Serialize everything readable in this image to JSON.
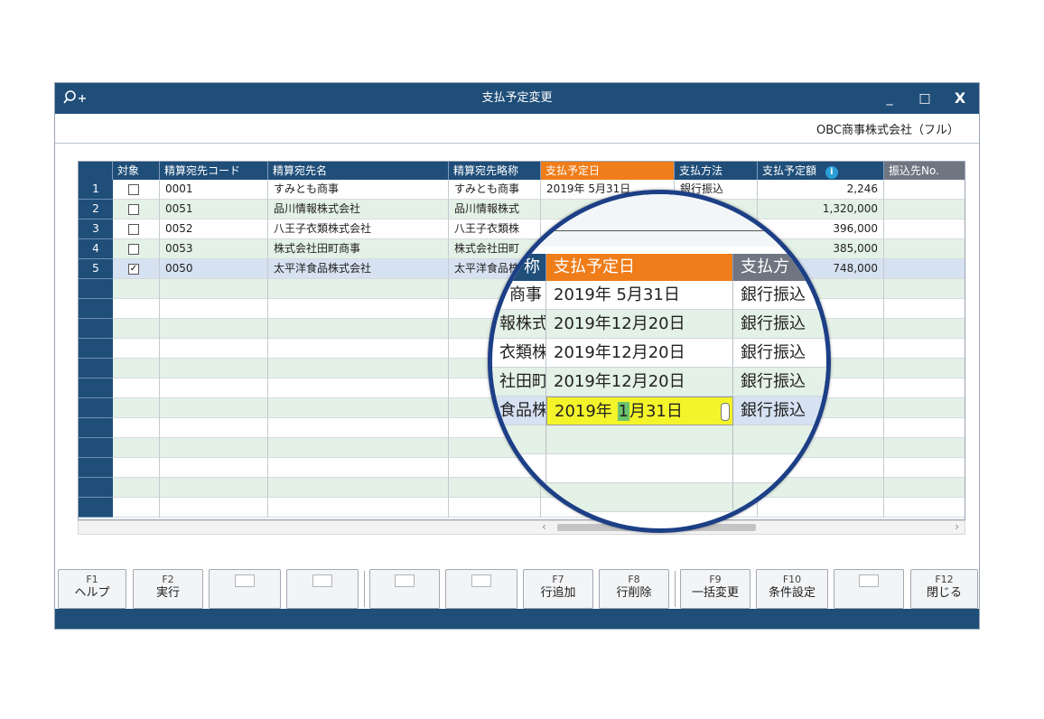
{
  "window": {
    "title": "支払予定変更",
    "company": "OBC商事株式会社（フル）",
    "controls": {
      "minimize": "_",
      "maximize": "□",
      "close": "X"
    }
  },
  "icons": {
    "search": "search-plus-icon"
  },
  "grid": {
    "headers": [
      "対象",
      "精算宛先コード",
      "精算宛先名",
      "精算宛先略称",
      "支払予定日",
      "支払方法",
      "支払予定額",
      "振込先No."
    ],
    "info_icon": "i",
    "rows": [
      {
        "no": "1",
        "checked": "",
        "code": "0001",
        "name": "すみとも商事",
        "short": "すみとも商事",
        "date": "2019年 5月31日",
        "method": "銀行振込",
        "amount": "2,246"
      },
      {
        "no": "2",
        "checked": "",
        "code": "0051",
        "name": "品川情報株式会社",
        "short": "品川情報株式",
        "date": "2019年12月20日",
        "method": "銀行振込",
        "amount": "1,320,000"
      },
      {
        "no": "3",
        "checked": "",
        "code": "0052",
        "name": "八王子衣類株式会社",
        "short": "八王子衣類株",
        "date": "2019年12月20日",
        "method": "銀行振込",
        "amount": "396,000"
      },
      {
        "no": "4",
        "checked": "",
        "code": "0053",
        "name": "株式会社田町商事",
        "short": "株式会社田町",
        "date": "2019年12月20日",
        "method": "銀行振込",
        "amount": "385,000"
      },
      {
        "no": "5",
        "checked": "✓",
        "code": "0050",
        "name": "太平洋食品株式会社",
        "short": "太平洋食品株",
        "date": "2019年 1月31日",
        "method": "銀行振込",
        "amount": "748,000"
      }
    ]
  },
  "magnifier": {
    "header_short_tail": "称",
    "header_date": "支払予定日",
    "header_method": "支払方",
    "short_tails": [
      "商事",
      "報株式",
      "衣類株",
      "社田町",
      "食品株"
    ],
    "dates": [
      "2019年 5月31日",
      "2019年12月20日",
      "2019年12月20日",
      "2019年12月20日"
    ],
    "edit_prefix": "2019年 ",
    "edit_caret": "1",
    "edit_suffix": "月31日",
    "methods": [
      "銀行振込",
      "銀行振込",
      "銀行振込",
      "銀行振込",
      "銀行振込"
    ]
  },
  "scroll": {
    "left_arrow": "‹",
    "right_arrow": "›"
  },
  "function_keys": [
    {
      "key": "F1",
      "label": "ヘルプ"
    },
    {
      "key": "F2",
      "label": "実行"
    },
    {
      "key": "",
      "label": ""
    },
    {
      "key": "",
      "label": ""
    },
    {
      "key": "",
      "label": ""
    },
    {
      "key": "",
      "label": ""
    },
    {
      "key": "F7",
      "label": "行追加"
    },
    {
      "key": "F8",
      "label": "行削除"
    },
    {
      "key": "F9",
      "label": "一括変更"
    },
    {
      "key": "F10",
      "label": "条件設定"
    },
    {
      "key": "",
      "label": ""
    },
    {
      "key": "F12",
      "label": "閉じる"
    }
  ]
}
